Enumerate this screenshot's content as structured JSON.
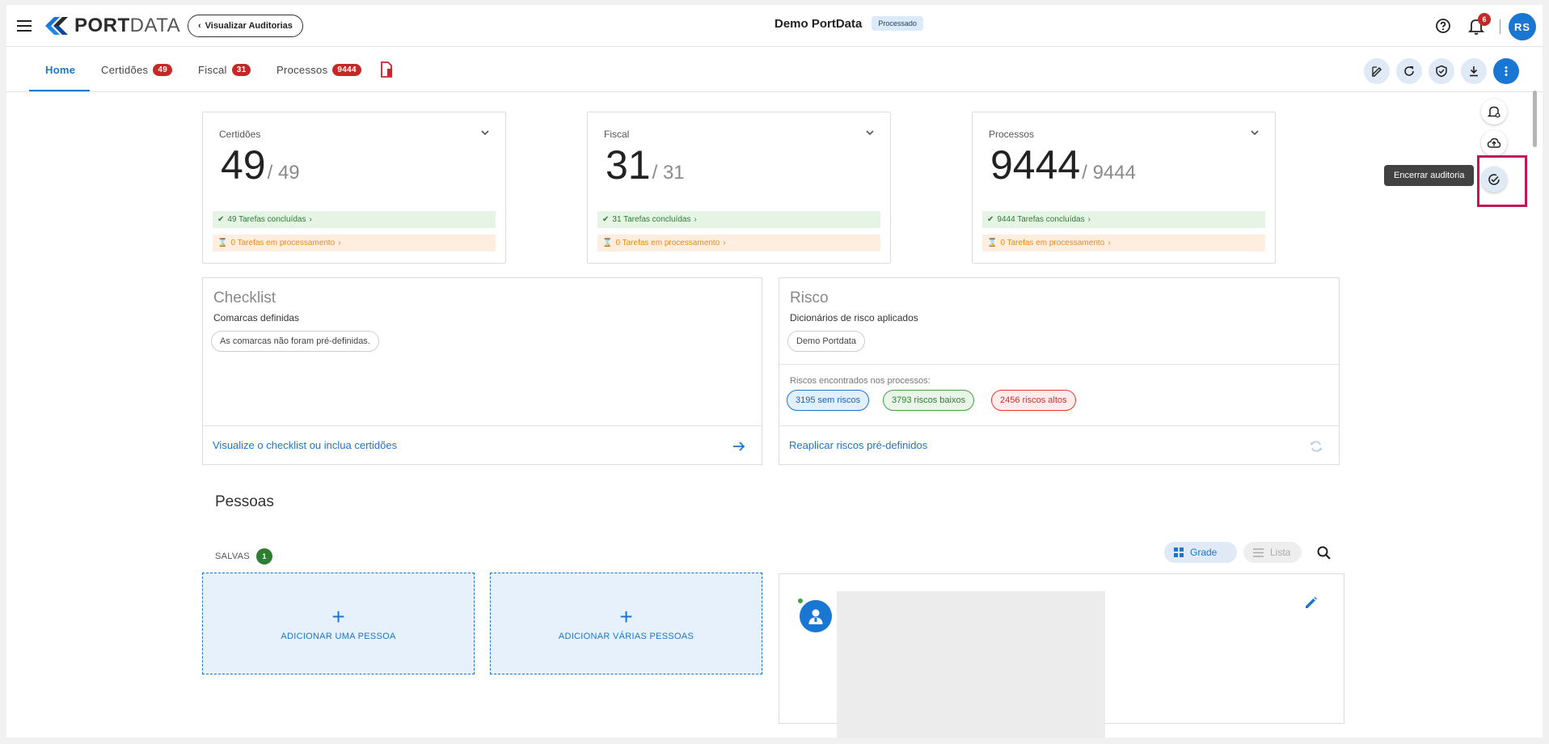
{
  "app": {
    "logo_bold": "PORT",
    "logo_thin": "DATA",
    "back_button": "Visualizar Auditorias",
    "audit_name": "Demo PortData",
    "audit_status": "Processado",
    "notification_count": "6",
    "user_initials": "RS"
  },
  "tabs": [
    {
      "label": "Home",
      "count": ""
    },
    {
      "label": "Certidões",
      "count": "49"
    },
    {
      "label": "Fiscal",
      "count": "31"
    },
    {
      "label": "Processos",
      "count": "9444"
    }
  ],
  "toolbar": {
    "icons": [
      "edit-icon",
      "refresh-icon",
      "shield-check-icon",
      "download-icon",
      "more-vert-icon"
    ]
  },
  "fab_menu": {
    "icons": [
      "bell-settings-icon",
      "cloud-upload-icon",
      "check-circle-icon"
    ],
    "tooltip": "Encerrar auditoria"
  },
  "summary_cards": [
    {
      "label": "Certidões",
      "value": "49",
      "total": "/ 49",
      "done": "49 Tarefas concluídas",
      "processing": "0 Tarefas em processamento"
    },
    {
      "label": "Fiscal",
      "value": "31",
      "total": "/ 31",
      "done": "31 Tarefas concluídas",
      "processing": "0 Tarefas em processamento"
    },
    {
      "label": "Processos",
      "value": "9444",
      "total": "/ 9444",
      "done": "9444 Tarefas concluídas",
      "processing": "0 Tarefas em processamento"
    }
  ],
  "checklist": {
    "title": "Checklist",
    "subtitle": "Comarcas definidas",
    "chip": "As comarcas não foram pré-definidas.",
    "footer_link": "Visualize o checklist ou inclua certidões"
  },
  "risco": {
    "title": "Risco",
    "subtitle": "Dicionários de risco aplicados",
    "chip": "Demo Portdata",
    "found_label": "Riscos encontrados nos processos:",
    "no_risk": "3195 sem riscos",
    "low_risk": "3793 riscos baixos",
    "high_risk": "2456 riscos altos",
    "footer_link": "Reaplicar riscos pré-definidos"
  },
  "pessoas": {
    "title": "Pessoas",
    "saved_label": "SALVAS",
    "saved_count": "1",
    "grid_label": "Grade",
    "list_label": "Lista",
    "add_one": "ADICIONAR UMA PESSOA",
    "add_many": "ADICIONAR VÁRIAS PESSOAS"
  },
  "colors": {
    "primary": "#1976d2",
    "badge_red": "#c62828",
    "success": "#2e7d32",
    "warning": "#ef8a1e",
    "highlight": "#c2185b"
  }
}
